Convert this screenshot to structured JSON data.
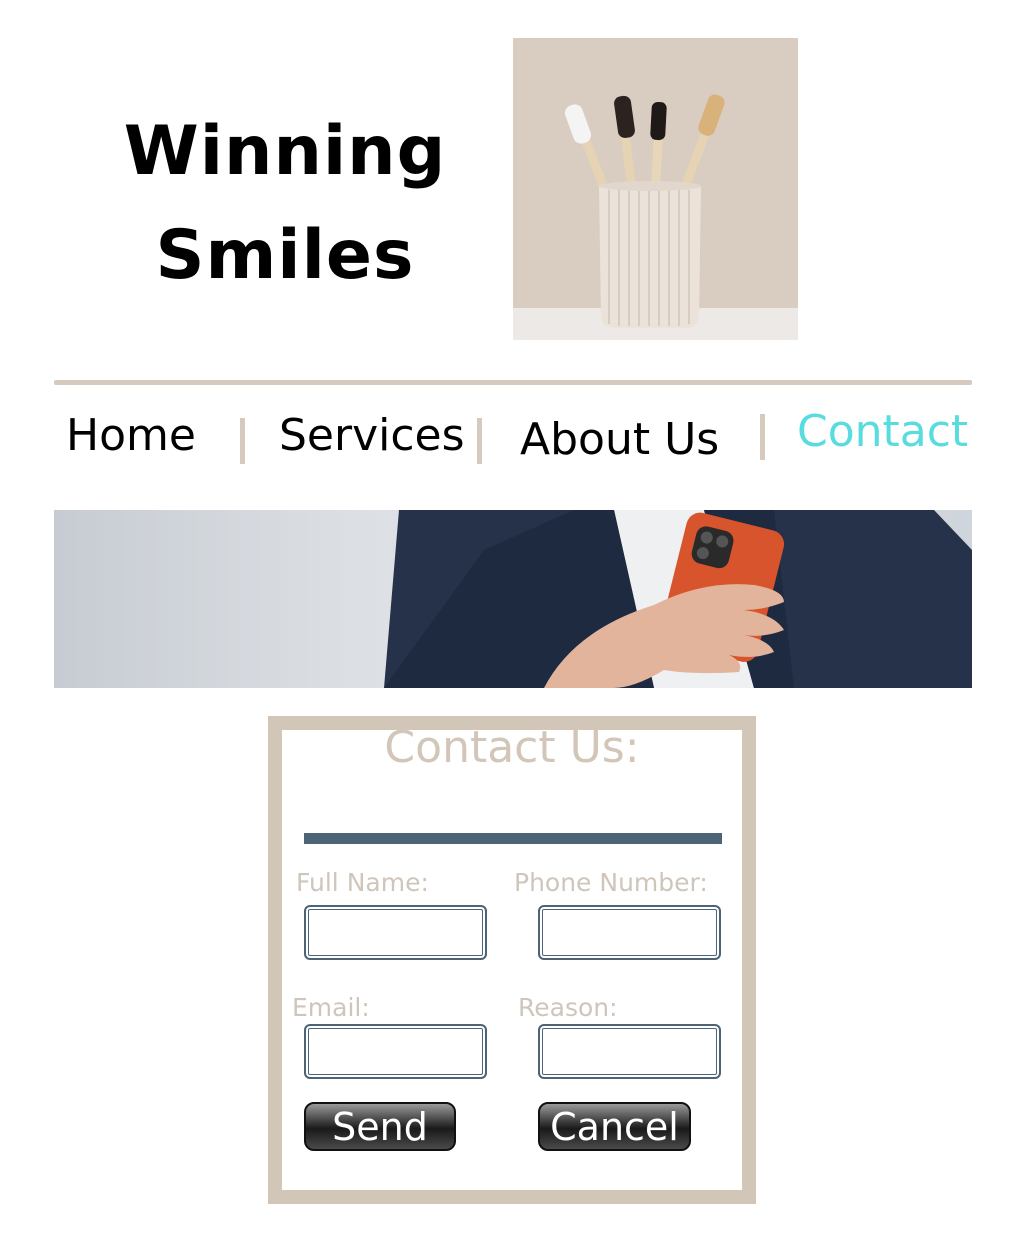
{
  "brand": {
    "line1": "Winning",
    "line2": "Smiles"
  },
  "nav": {
    "home": "Home",
    "services": "Services",
    "about": "About Us",
    "contact": "Contact"
  },
  "contact_form": {
    "title": "Contact Us:",
    "full_name_label": "Full Name:",
    "phone_label": "Phone Number:",
    "email_label": "Email:",
    "reason_label": "Reason:",
    "full_name_value": "",
    "phone_value": "",
    "email_value": "",
    "reason_value": "",
    "send_label": "Send",
    "cancel_label": "Cancel"
  },
  "colors": {
    "accent_nav_active": "#58dcdf",
    "form_border": "#d2c6b9",
    "form_bar": "#4d6477",
    "divider": "#d6c9be"
  }
}
